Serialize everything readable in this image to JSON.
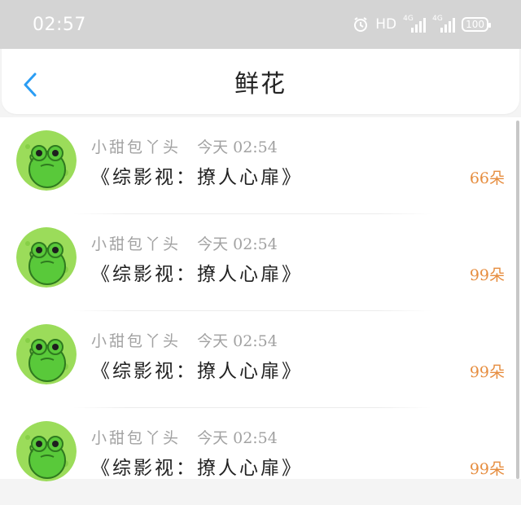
{
  "status_bar": {
    "time": "02:57",
    "hd": "HD",
    "net1": "4G",
    "net2": "4G",
    "battery": "100"
  },
  "nav": {
    "title": "鲜花"
  },
  "colors": {
    "accent": "#2a9df4",
    "count": "#e68d3f",
    "avatar_bg": "#9bdc5a",
    "frog": "#59c93a"
  },
  "items": [
    {
      "sender": "小甜包丫头",
      "time": "今天 02:54",
      "book": "《综影视：撩人心扉》",
      "count": "66朵"
    },
    {
      "sender": "小甜包丫头",
      "time": "今天 02:54",
      "book": "《综影视：撩人心扉》",
      "count": "99朵"
    },
    {
      "sender": "小甜包丫头",
      "time": "今天 02:54",
      "book": "《综影视：撩人心扉》",
      "count": "99朵"
    },
    {
      "sender": "小甜包丫头",
      "time": "今天 02:54",
      "book": "《综影视：撩人心扉》",
      "count": "99朵"
    }
  ]
}
